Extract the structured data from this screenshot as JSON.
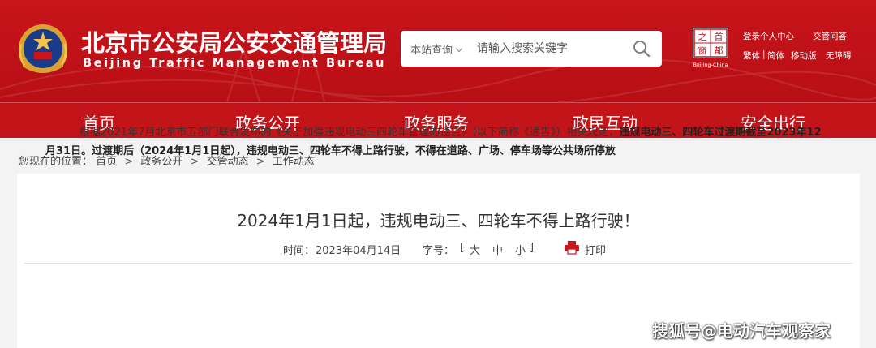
{
  "header": {
    "title": "北京市公安局公安交通管理局",
    "subtitle": "Beijing Traffic Management Bureau",
    "logo_capital": {
      "chars": [
        "首",
        "都",
        "之",
        "窗"
      ],
      "caption": "Beijing-China"
    },
    "top_links": {
      "personal_center": "登录个人中心",
      "qa": "交管问答",
      "traditional": "繁体",
      "simplified": "简体",
      "mobile": "移动版",
      "accessible": "无障碍",
      "separator": "|"
    }
  },
  "search": {
    "scope": "本站查询",
    "placeholder": "请输入搜索关键字"
  },
  "nav": {
    "items": [
      {
        "label": "首页"
      },
      {
        "label": "政务公开"
      },
      {
        "label": "政务服务"
      },
      {
        "label": "政民互动"
      },
      {
        "label": "安全出行"
      }
    ]
  },
  "breadcrumb": {
    "prefix": "您现在的位置：",
    "items": [
      "首页",
      "政务公开",
      "交管动态",
      "工作动态"
    ],
    "separator": ">"
  },
  "article": {
    "title": "2024年1月1日起，违规电动三、四轮车不得上路行驶！",
    "meta": {
      "time_label": "时间：",
      "time_value": "2023年04月14日",
      "fontsize_label": "字号：",
      "bracket_open": "[",
      "size_large": "大",
      "size_medium": "中",
      "size_small": "小",
      "bracket_close": "]",
      "print_label": "打印"
    },
    "paragraph": {
      "normal_1": "根据2021年7月北京市五部门联合发布的《关于加强违规电动三四轮车管理的通告》（以下简称《通告》）相关规定，",
      "bold_1": "违规电动三、四轮车过渡期截至2023年12月31日。过渡期后（2024年1月1日起），违规电动三、四轮车不得上路行驶，不得在道路、广场、停车场等公共场所停放"
    }
  },
  "watermark": "搜狐号@电动汽车观察家",
  "colors": {
    "header_red": "#c9141b",
    "nav_red": "#c3141a",
    "page_bg": "#f3f3f3",
    "print_icon_red": "#c8161d"
  }
}
